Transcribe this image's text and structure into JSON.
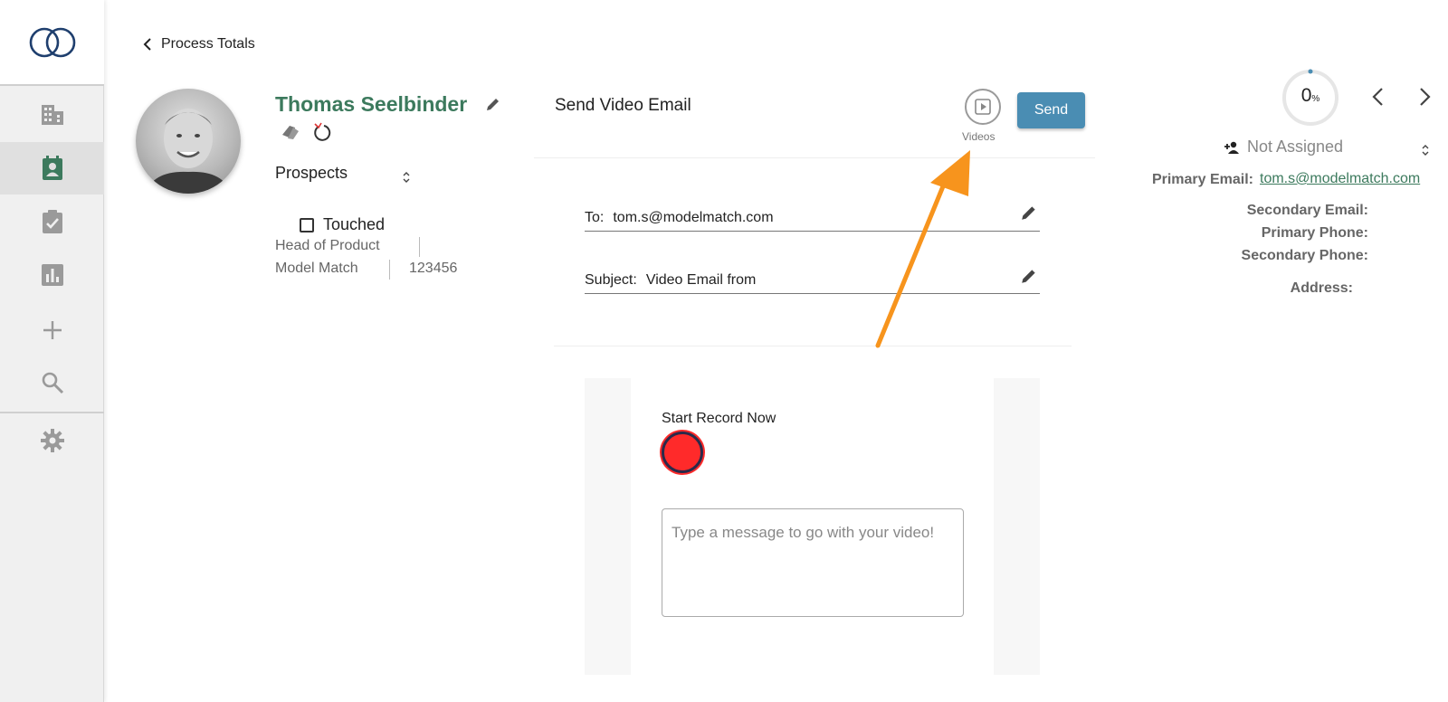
{
  "breadcrumb": {
    "label": "Process Totals"
  },
  "contact": {
    "name": "Thomas Seelbinder",
    "list_name": "Prospects",
    "status_checkbox_label": "Touched",
    "title": "Head of Product",
    "company": "Model Match",
    "id": "123456"
  },
  "email_panel": {
    "title": "Send Video Email",
    "videos_label": "Videos",
    "send_label": "Send",
    "to_label": "To:",
    "to_value": "tom.s@modelmatch.com",
    "subject_label": "Subject:",
    "subject_value": "Video Email from",
    "record_label": "Start Record Now",
    "message_placeholder": "Type a message to go with your video!"
  },
  "right_panel": {
    "progress_value": "0",
    "progress_unit": "%",
    "assignee": "Not Assigned",
    "primary_email_label": "Primary Email:",
    "primary_email_value": "tom.s@modelmatch.com",
    "secondary_email_label": "Secondary Email:",
    "primary_phone_label": "Primary Phone:",
    "secondary_phone_label": "Secondary Phone:",
    "address_label": "Address:"
  },
  "sidebar": {
    "items": [
      "building-icon",
      "contact-card-icon",
      "task-check-icon",
      "report-chart-icon",
      "plus-icon",
      "search-icon",
      "gear-icon"
    ],
    "active": "contact-card-icon"
  },
  "colors": {
    "accent_green": "#3c7a5d",
    "send_button": "#4a8db3",
    "record_red": "#ff2a2a",
    "annotation_arrow": "#f7941d"
  }
}
